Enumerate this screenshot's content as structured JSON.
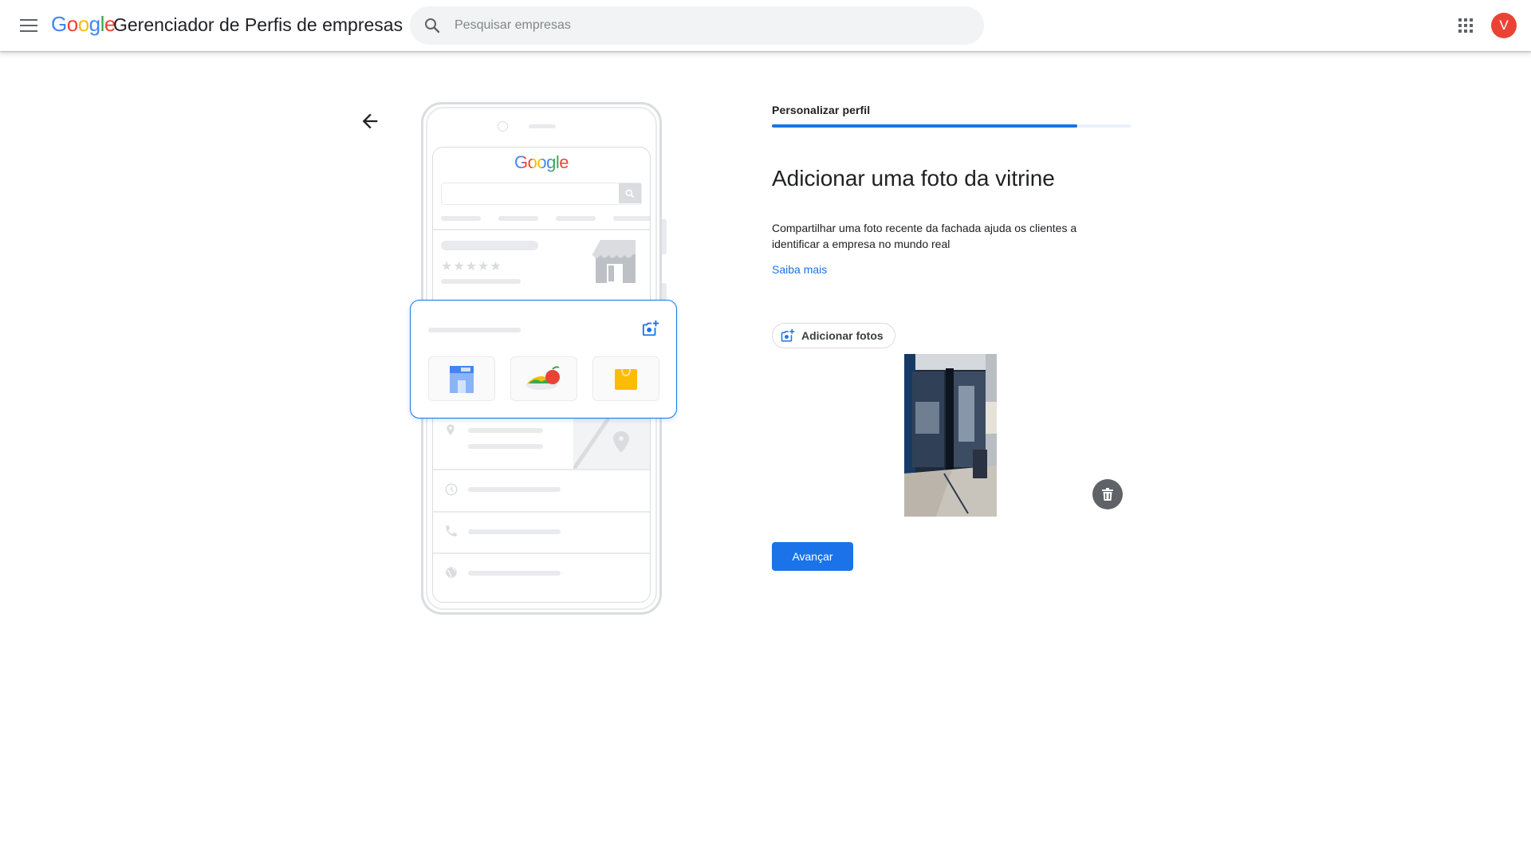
{
  "header": {
    "logo_letters": [
      "G",
      "o",
      "o",
      "g",
      "l",
      "e"
    ],
    "app_title": "Gerenciador de Perfis de empresas",
    "search_placeholder": "Pesquisar empresas",
    "avatar_initial": "V"
  },
  "illustration": {
    "google_wordmark": "Google",
    "rating_stars": [
      "★",
      "★",
      "★",
      "★",
      "★"
    ]
  },
  "step": {
    "label": "Personalizar perfil",
    "progress_fraction": 0.85
  },
  "main": {
    "title": "Adicionar uma foto da vitrine",
    "description": "Compartilhar uma foto recente da fachada ajuda os clientes a identificar a empresa no mundo real",
    "learn_more": "Saiba mais",
    "add_photos_label": "Adicionar fotos",
    "next_label": "Avançar"
  },
  "colors": {
    "primary": "#1a73e8",
    "avatar": "#ea4335",
    "google_blue": "#4285f4",
    "google_red": "#ea4335",
    "google_yellow": "#fbbc05",
    "google_green": "#34a853"
  },
  "icons": [
    "menu-icon",
    "search-icon",
    "apps-grid-icon",
    "back-arrow-icon",
    "add-photo-icon",
    "trash-icon",
    "location-pin-icon",
    "clock-icon",
    "phone-icon",
    "globe-icon",
    "storefront-icon"
  ]
}
